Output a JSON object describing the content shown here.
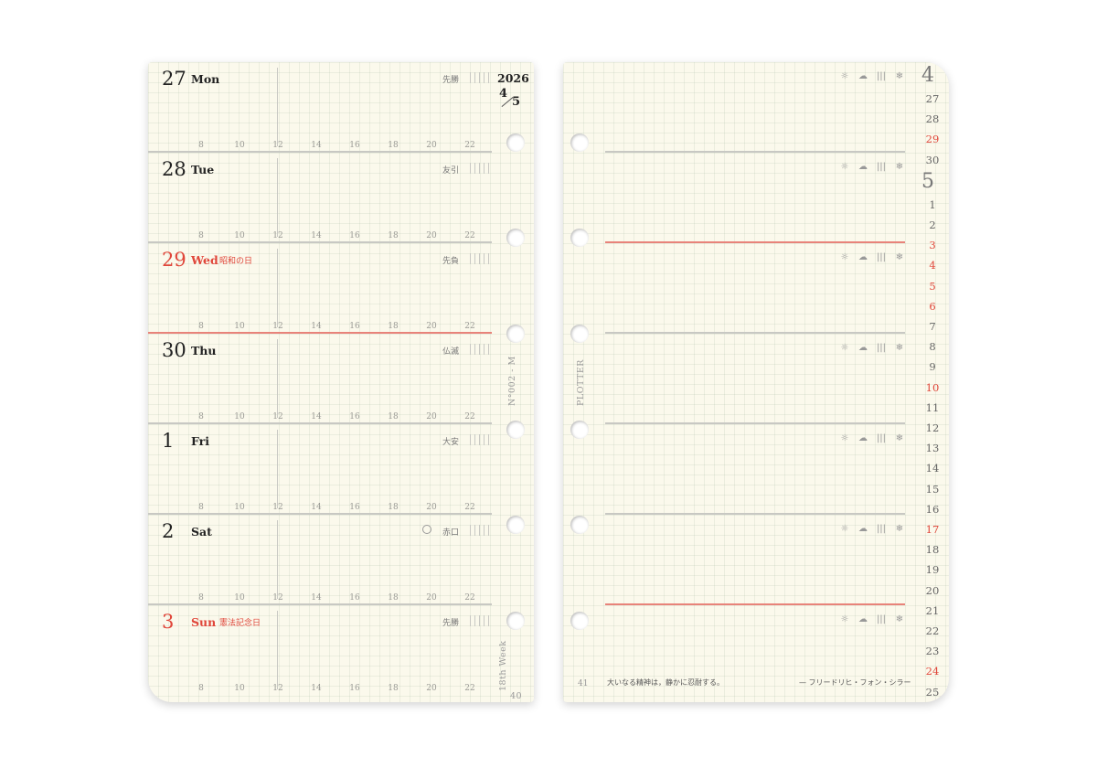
{
  "header": {
    "year": "2026",
    "month_a": "4",
    "month_b": "5"
  },
  "days": [
    {
      "num": "27",
      "weekday": "Mon",
      "holiday": "",
      "rokuyo": "先勝",
      "red": false,
      "moon": false
    },
    {
      "num": "28",
      "weekday": "Tue",
      "holiday": "",
      "rokuyo": "友引",
      "red": false,
      "moon": false
    },
    {
      "num": "29",
      "weekday": "Wed",
      "holiday": "昭和の日",
      "rokuyo": "先負",
      "red": true,
      "moon": false
    },
    {
      "num": "30",
      "weekday": "Thu",
      "holiday": "",
      "rokuyo": "仏滅",
      "red": false,
      "moon": false
    },
    {
      "num": "1",
      "weekday": "Fri",
      "holiday": "",
      "rokuyo": "大安",
      "red": false,
      "moon": false
    },
    {
      "num": "2",
      "weekday": "Sat",
      "holiday": "",
      "rokuyo": "赤口",
      "red": false,
      "moon": true
    },
    {
      "num": "3",
      "weekday": "Sun",
      "holiday": "憲法記念日",
      "rokuyo": "先勝",
      "red": true,
      "moon": false
    }
  ],
  "hours": [
    "8",
    "10",
    "12",
    "14",
    "16",
    "18",
    "20",
    "22"
  ],
  "side_text": {
    "serial": "N°002 - M",
    "week": "18th Week",
    "page_left": "40",
    "brand": "PLOTTER"
  },
  "weather_icons": [
    "☼",
    "☁",
    "|||",
    "❄"
  ],
  "mini_calendar": [
    {
      "text": "4",
      "type": "month"
    },
    {
      "text": "27",
      "type": "day",
      "red": false
    },
    {
      "text": "28",
      "type": "day",
      "red": false
    },
    {
      "text": "29",
      "type": "day",
      "red": true
    },
    {
      "text": "30",
      "type": "day",
      "red": false
    },
    {
      "text": "5",
      "type": "month"
    },
    {
      "text": "1",
      "type": "day",
      "red": false
    },
    {
      "text": "2",
      "type": "day",
      "red": false
    },
    {
      "text": "3",
      "type": "day",
      "red": true
    },
    {
      "text": "4",
      "type": "day",
      "red": true
    },
    {
      "text": "5",
      "type": "day",
      "red": true
    },
    {
      "text": "6",
      "type": "day",
      "red": true
    },
    {
      "text": "7",
      "type": "day",
      "red": false
    },
    {
      "text": "8",
      "type": "day",
      "red": false
    },
    {
      "text": "9",
      "type": "day",
      "red": false
    },
    {
      "text": "10",
      "type": "day",
      "red": true
    },
    {
      "text": "11",
      "type": "day",
      "red": false
    },
    {
      "text": "12",
      "type": "day",
      "red": false
    },
    {
      "text": "13",
      "type": "day",
      "red": false
    },
    {
      "text": "14",
      "type": "day",
      "red": false
    },
    {
      "text": "15",
      "type": "day",
      "red": false
    },
    {
      "text": "16",
      "type": "day",
      "red": false
    },
    {
      "text": "17",
      "type": "day",
      "red": true
    },
    {
      "text": "18",
      "type": "day",
      "red": false
    },
    {
      "text": "19",
      "type": "day",
      "red": false
    },
    {
      "text": "20",
      "type": "day",
      "red": false
    },
    {
      "text": "21",
      "type": "day",
      "red": false
    },
    {
      "text": "22",
      "type": "day",
      "red": false
    },
    {
      "text": "23",
      "type": "day",
      "red": false
    },
    {
      "text": "24",
      "type": "day",
      "red": true
    },
    {
      "text": "25",
      "type": "day",
      "red": false
    }
  ],
  "footer": {
    "page_right": "41",
    "quote": "大いなる精神は，静かに忍耐する。",
    "author": "— フリードリヒ・フォン・シラー"
  }
}
